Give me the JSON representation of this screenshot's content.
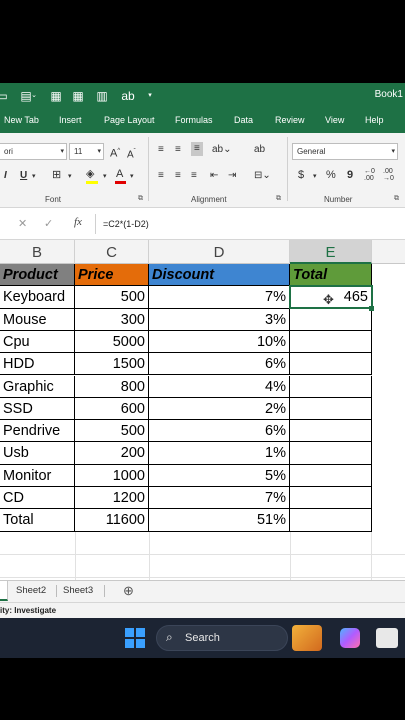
{
  "app": {
    "title": "Book1"
  },
  "ribbon_tabs": [
    "New Tab",
    "Insert",
    "Page Layout",
    "Formulas",
    "Data",
    "Review",
    "View",
    "Help"
  ],
  "ribbon": {
    "font_name": "ori",
    "font_size": "11",
    "bold_label": "I",
    "underline_label": "U",
    "grow_font": "A",
    "shrink_font": "A",
    "number_format": "General",
    "currency": "$",
    "percent": "%",
    "comma": "9",
    "groups": {
      "font": "Font",
      "alignment": "Alignment",
      "number": "Number"
    }
  },
  "formula_bar": {
    "cancel": "✕",
    "enter": "✓",
    "fx": "fx",
    "formula": "=C2*(1-D2)"
  },
  "columns": [
    "B",
    "C",
    "D",
    "E"
  ],
  "table": {
    "headers": {
      "product": "Product",
      "price": "Price",
      "discount": "Discount",
      "total": "Total"
    },
    "rows": [
      {
        "product": "Keyboard",
        "price": "500",
        "discount": "7%",
        "total": "465"
      },
      {
        "product": "Mouse",
        "price": "300",
        "discount": "3%",
        "total": ""
      },
      {
        "product": "Cpu",
        "price": "5000",
        "discount": "10%",
        "total": ""
      },
      {
        "product": "HDD",
        "price": "1500",
        "discount": "6%",
        "total": ""
      },
      {
        "product": "Graphic",
        "price": "800",
        "discount": "4%",
        "total": ""
      },
      {
        "product": "SSD",
        "price": "600",
        "discount": "2%",
        "total": ""
      },
      {
        "product": "Pendrive",
        "price": "500",
        "discount": "6%",
        "total": ""
      },
      {
        "product": "Usb",
        "price": "200",
        "discount": "1%",
        "total": ""
      },
      {
        "product": "Monitor",
        "price": "1000",
        "discount": "5%",
        "total": ""
      },
      {
        "product": "CD",
        "price": "1200",
        "discount": "7%",
        "total": ""
      },
      {
        "product": "Total",
        "price": "11600",
        "discount": "51%",
        "total": ""
      }
    ]
  },
  "colors": {
    "product_header": "#808080",
    "price_header": "#e46c0a",
    "discount_header": "#3e85d1",
    "total_header": "#5f9b3a",
    "excel_green": "#1e7145"
  },
  "sheets": [
    "Sheet2",
    "Sheet3"
  ],
  "add_sheet": "⊕",
  "status": {
    "accessibility": "ity: Investigate"
  },
  "taskbar": {
    "search_label": "Search"
  }
}
